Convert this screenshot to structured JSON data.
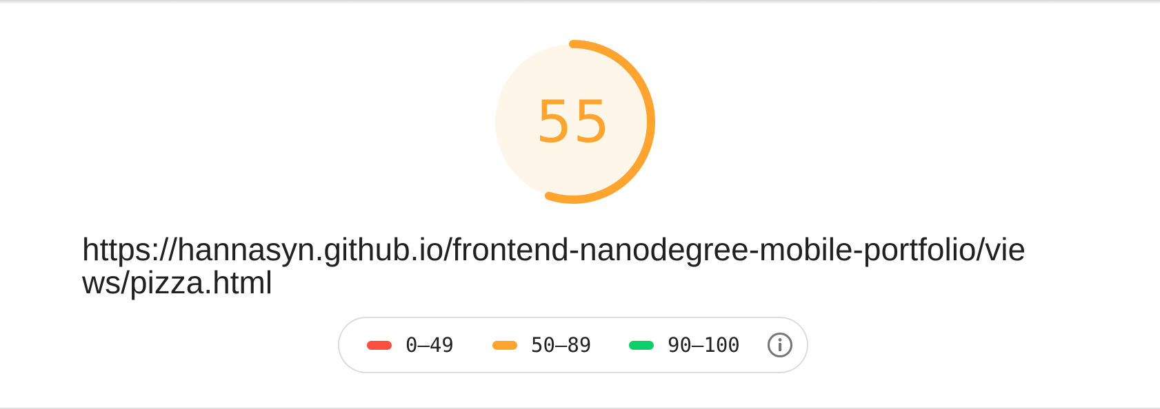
{
  "report": {
    "score": "55",
    "score_fraction": 0.55,
    "url": "https://hannasyn.github.io/frontend-nanodegree-mobile-portfolio/views/pizza.html"
  },
  "legend": {
    "items": [
      {
        "range": "0–49",
        "color": "#ff4e42"
      },
      {
        "range": "50–89",
        "color": "#ffa42f"
      },
      {
        "range": "90–100",
        "color": "#0cce6b"
      }
    ],
    "info_icon": "info-icon"
  },
  "colors": {
    "average_accent": "#ffa42f",
    "average_fill": "#fff6ea",
    "text": "#212121",
    "border": "#dcdcdc"
  }
}
